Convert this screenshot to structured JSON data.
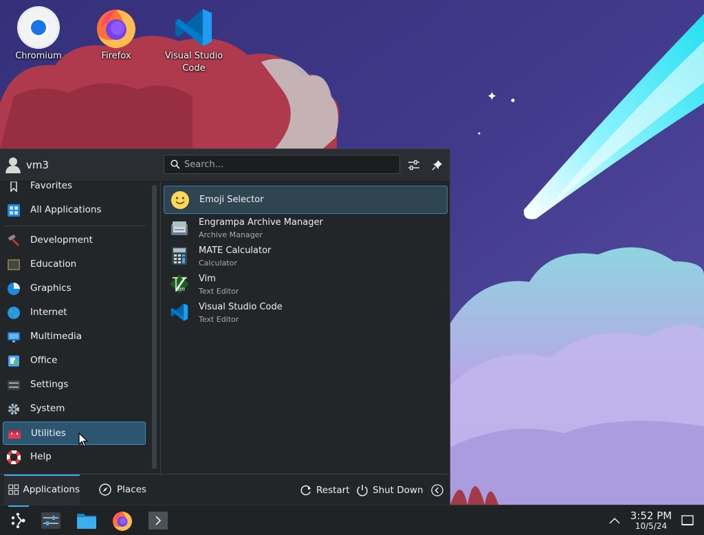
{
  "desktop": {
    "icons": [
      {
        "label": "Chromium",
        "icon": "chromium-icon"
      },
      {
        "label": "Firefox",
        "icon": "firefox-icon"
      },
      {
        "label_line1": "Visual Studio",
        "label_line2": "Code",
        "icon": "vscode-icon"
      }
    ]
  },
  "launcher": {
    "user": "vm3",
    "search_placeholder": "Search...",
    "sidebar": {
      "items": [
        {
          "label": "Favorites",
          "icon": "bookmark-icon"
        },
        {
          "label": "All Applications",
          "icon": "grid-icon"
        },
        {
          "label": "Development",
          "icon": "hammer-icon"
        },
        {
          "label": "Education",
          "icon": "chalkboard-icon"
        },
        {
          "label": "Graphics",
          "icon": "graphics-icon"
        },
        {
          "label": "Internet",
          "icon": "globe-icon"
        },
        {
          "label": "Multimedia",
          "icon": "monitor-icon"
        },
        {
          "label": "Office",
          "icon": "office-icon"
        },
        {
          "label": "Settings",
          "icon": "settings-sliders-icon"
        },
        {
          "label": "System",
          "icon": "gear-icon"
        },
        {
          "label": "Utilities",
          "icon": "toolbox-icon",
          "selected": true
        },
        {
          "label": "Help",
          "icon": "lifebuoy-icon"
        }
      ]
    },
    "apps": [
      {
        "name": "Emoji Selector",
        "desc": "",
        "icon": "emoji-icon",
        "selected": true
      },
      {
        "name": "Engrampa Archive Manager",
        "desc": "Archive Manager",
        "icon": "archive-icon"
      },
      {
        "name": "MATE Calculator",
        "desc": "Calculator",
        "icon": "calculator-icon"
      },
      {
        "name": "Vim",
        "desc": "Text Editor",
        "icon": "vim-icon"
      },
      {
        "name": "Visual Studio Code",
        "desc": "Text Editor",
        "icon": "vscode-icon"
      }
    ],
    "footer": {
      "tab_applications": "Applications",
      "tab_places": "Places",
      "restart": "Restart",
      "shutdown": "Shut Down"
    }
  },
  "taskbar": {
    "time": "3:52 PM",
    "date": "10/5/24"
  },
  "colors": {
    "accent": "#3daee9",
    "panel_bg": "#232629",
    "selected_bg": "#2c5570"
  }
}
